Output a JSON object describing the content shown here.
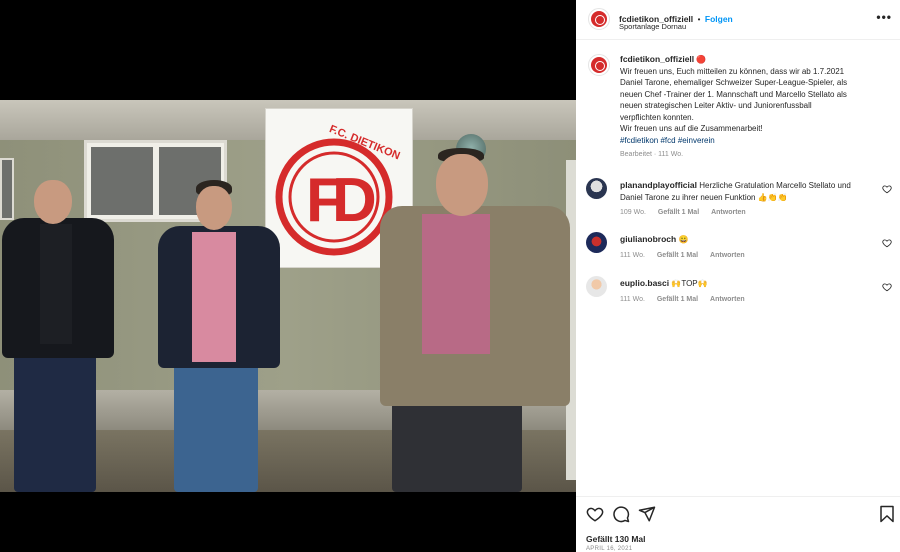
{
  "post": {
    "username": "fcdietikon_offiziell",
    "separator": "•",
    "follow_label": "Folgen",
    "location": "Sportanlage Dornau",
    "more_label": "•••",
    "sign_text": "F.C. DIETIKON",
    "caption": {
      "username": "fcdietikon_offiziell",
      "emoji": "🔴",
      "line1": "Wir freuen uns, Euch mitteilen zu können, dass wir ab 1.7.2021",
      "line2": "Daniel Tarone, ehemaliger Schweizer Super-League-Spieler, als",
      "line3": "neuen Chef -Trainer der 1. Mannschaft und Marcello Stellato als",
      "line4": "neuen strategischen Leiter Aktiv- und Juniorenfussball",
      "line5": "verpflichten konnten.",
      "line6": "Wir freuen uns auf die Zusammenarbeit!",
      "hashtags": "#fcdietikon #fcd #einverein",
      "meta": "Bearbeitet · 111 Wo."
    },
    "comments": [
      {
        "username": "planandplayofficial",
        "text_line1": "Herzliche Gratulation Marcello Stellato und",
        "text_line2": "Daniel Tarone zu ihrer neuen Funktion 👍👏👏",
        "time": "109 Wo.",
        "likes": "Gefällt 1 Mal",
        "reply": "Antworten"
      },
      {
        "username": "giulianobroch",
        "text_line1": "😀",
        "text_line2": "",
        "time": "111 Wo.",
        "likes": "Gefällt 1 Mal",
        "reply": "Antworten"
      },
      {
        "username": "euplio.basci",
        "text_line1": "🙌TOP🙌",
        "text_line2": "",
        "time": "111 Wo.",
        "likes": "Gefällt 1 Mal",
        "reply": "Antworten"
      }
    ],
    "likes_total": "Gefällt 130 Mal",
    "date": "APRIL 16, 2021"
  },
  "colors": {
    "club_red": "#d52b2b",
    "link_blue": "#0095f6",
    "hashtag_blue": "#00376b",
    "meta_gray": "#8e8e8e"
  },
  "icons": [
    "heart-icon",
    "comment-icon",
    "share-icon",
    "bookmark-icon",
    "more-icon"
  ]
}
